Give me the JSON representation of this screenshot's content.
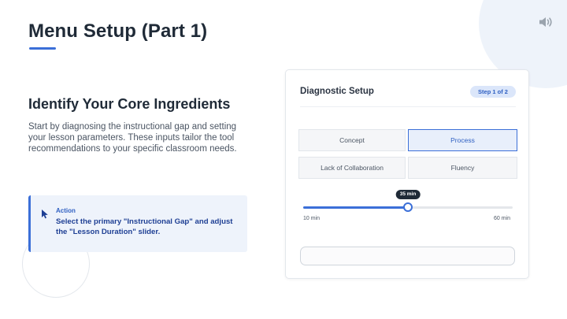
{
  "header": {
    "title": "Menu Setup (Part 1)",
    "accent_color": "#3b6fd8",
    "sound_icon": "speaker-icon"
  },
  "content": {
    "heading": "Identify Your Core Ingredients",
    "body": "Start by diagnosing the instructional gap and setting your lesson parameters. These inputs tailor the tool recommendations to your specific classroom needs."
  },
  "action": {
    "label": "Action",
    "text": "Select the primary \"Instructional Gap\" and adjust the \"Lesson Duration\" slider.",
    "icon": "cursor-icon"
  },
  "panel": {
    "title": "Diagnostic Setup",
    "step_badge": "Step 1 of 2",
    "options": [
      {
        "label": "Concept",
        "selected": false
      },
      {
        "label": "Process",
        "selected": true
      },
      {
        "label": "Lack of Collaboration",
        "selected": false
      },
      {
        "label": "Fluency",
        "selected": false
      }
    ],
    "slider": {
      "min_label": "10 min",
      "max_label": "60 min",
      "value_label": "35 min",
      "min": 10,
      "max": 60,
      "value": 35
    },
    "bottom_field": ""
  }
}
